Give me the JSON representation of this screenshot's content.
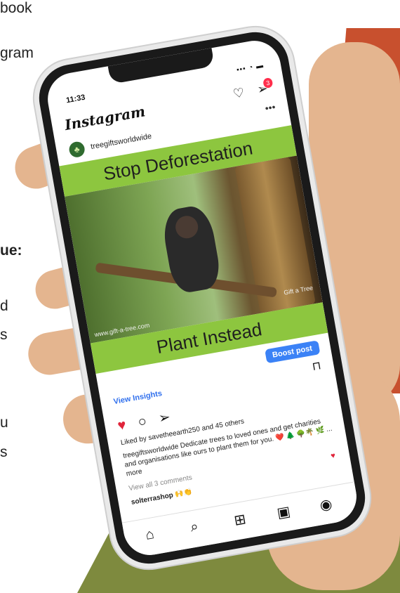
{
  "side_text": {
    "line1": "book",
    "line2": "gram",
    "line3": "ue:",
    "line4": "d",
    "line5": "s",
    "line6": "u",
    "line7": "s"
  },
  "status_bar": {
    "time": "11:33",
    "indicators": "▪▪▪ ◔ ▬"
  },
  "header": {
    "logo": "Instagram",
    "notifications_badge": "3",
    "more_icon": "•••"
  },
  "post": {
    "account": "treegiftsworldwide",
    "top_banner": "Stop Deforestation",
    "bottom_banner": "Plant Instead",
    "photo_credit": "www.gift-a-tree.com",
    "photo_logo": "Gift a Tree"
  },
  "boost_button": "Boost post",
  "view_insights": "View Insights",
  "likes_text": "Liked by savetheearth250 and 45 others",
  "caption": "treegiftsworldwide Dedicate trees to loved ones and get charities and organisations like ours to plant them for you. ❤️ 🌲 🌳🌴 🌿 ... more",
  "comments_link": "View all 3 comments",
  "commenter": "solterrashop 🙌👏",
  "nav": {
    "home_icon": "home-icon",
    "search_icon": "search-icon",
    "add_icon": "add-icon",
    "reels_icon": "reels-icon",
    "profile_icon": "profile-icon"
  },
  "colors": {
    "banner_green": "#8dc63f",
    "boost_blue": "#3b82f6",
    "bg_red": "#c8502e",
    "bg_olive": "#7e8a3e"
  }
}
